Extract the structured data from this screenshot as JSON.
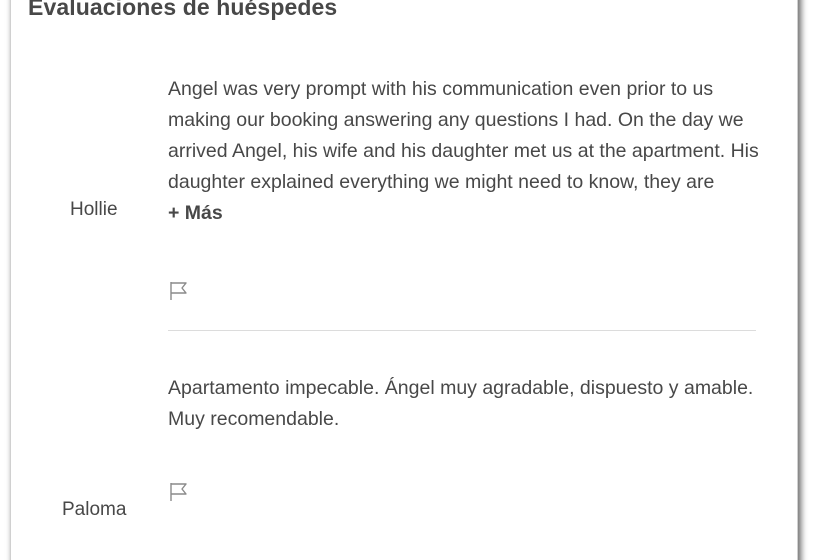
{
  "section": {
    "title": "Evaluaciones de huéspedes"
  },
  "reviews": [
    {
      "reviewer": "Hollie",
      "text": "Angel was very prompt with his communication even prior to us making our booking answering any questions I had. On the day we arrived Angel, his wife and his daughter met us at the apartment. His daughter explained everything we might need to know, they are",
      "more_label": "+ Más",
      "icon": "flag-icon"
    },
    {
      "reviewer": "Paloma",
      "text": "Apartamento impecable. Ángel muy agradable, dispuesto y amable. Muy recomendable.",
      "icon": "flag-icon"
    }
  ]
}
